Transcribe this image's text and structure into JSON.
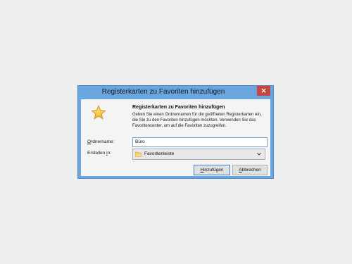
{
  "dialog": {
    "title": "Registerkarten zu Favoriten hinzufügen",
    "close_label": "✕",
    "heading": "Registerkarten zu Favoriten hinzufügen",
    "description": "Geben Sie einen Ordnernamen für die geöffneten Registerkarten ein, die Sie zu den Favoriten hinzufügen möchten. Verwenden Sie das Favoritencenter, um auf die Favoriten zuzugreifen.",
    "star_icon": "star-icon",
    "folder_name": {
      "label_accel": "O",
      "label_rest": "rdnername:",
      "value": "Büro"
    },
    "create_in": {
      "label_pre": "Erstellen ",
      "label_accel": "i",
      "label_post": "n:",
      "selected": "Favoritenleiste",
      "icon": "folder-icon"
    },
    "buttons": {
      "add_accel": "H",
      "add_rest": "inzufügen",
      "cancel_accel": "A",
      "cancel_rest": "bbrechen"
    }
  },
  "colors": {
    "titlebar": "#69a5df",
    "close": "#c7463f",
    "background": "#efefef",
    "client": "#f4f4f4"
  }
}
